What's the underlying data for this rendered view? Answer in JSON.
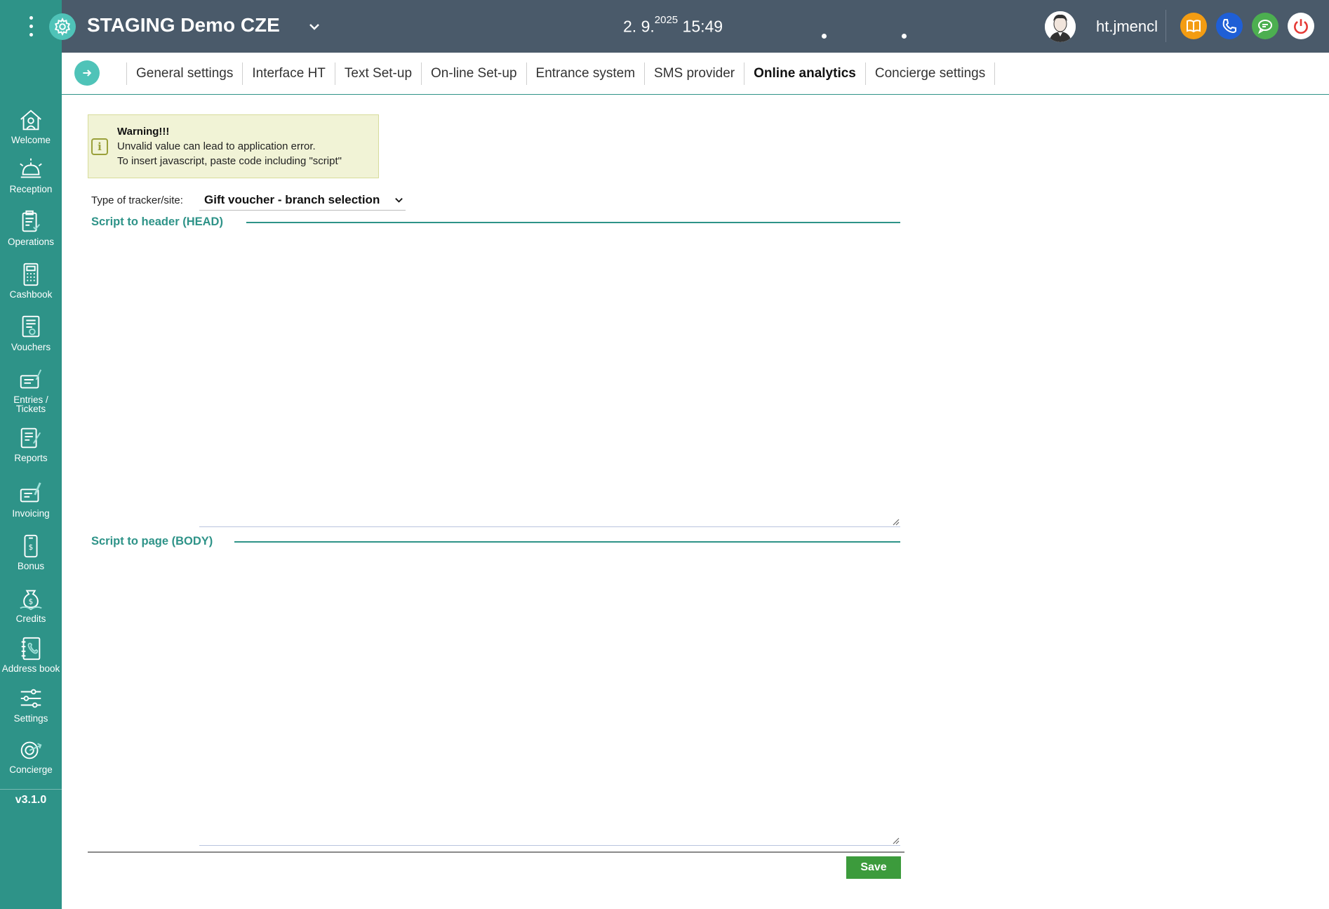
{
  "header": {
    "app_title": "STAGING Demo CZE",
    "date": "2. 9.",
    "year": "2025",
    "time": "15:49",
    "username": "ht.jmencl",
    "buttons": [
      {
        "name": "book",
        "color": "#f39c12"
      },
      {
        "name": "phone",
        "color": "#1f5fd6"
      },
      {
        "name": "chat",
        "color": "#4caf50"
      },
      {
        "name": "power",
        "color": "#ffffff"
      }
    ]
  },
  "sidebar": {
    "items": [
      {
        "label": "Welcome",
        "icon": "home-icon"
      },
      {
        "label": "Reception",
        "icon": "bell-icon"
      },
      {
        "label": "Operations",
        "icon": "clipboard-icon"
      },
      {
        "label": "Cashbook",
        "icon": "calculator-icon"
      },
      {
        "label": "Vouchers",
        "icon": "voucher-icon"
      },
      {
        "label": "Entries /",
        "label2": "Tickets",
        "icon": "ticket-icon"
      },
      {
        "label": "Reports",
        "icon": "report-icon"
      },
      {
        "label": "Invoicing",
        "icon": "invoice-icon"
      },
      {
        "label": "Bonus",
        "icon": "bonus-icon"
      },
      {
        "label": "Credits",
        "icon": "credits-icon"
      },
      {
        "label": "Address book",
        "icon": "address-book-icon"
      },
      {
        "label": "Settings",
        "icon": "sliders-icon"
      },
      {
        "label": "Concierge",
        "icon": "concierge-icon"
      }
    ],
    "version": "v3.1.0"
  },
  "tabs": [
    {
      "label": "General settings",
      "active": false
    },
    {
      "label": "Interface HT",
      "active": false
    },
    {
      "label": "Text Set-up",
      "active": false
    },
    {
      "label": "On-line Set-up",
      "active": false
    },
    {
      "label": "Entrance system",
      "active": false
    },
    {
      "label": "SMS provider",
      "active": false
    },
    {
      "label": "Online analytics",
      "active": true
    },
    {
      "label": "Concierge settings",
      "active": false
    }
  ],
  "warning": {
    "title": "Warning!!!",
    "line1": "Unvalid value can lead to application error.",
    "line2": "To insert javascript, paste code including \"script\""
  },
  "tracker": {
    "label": "Type of tracker/site:",
    "selected": "Gift voucher - branch selection"
  },
  "sections": {
    "head_title": "Script to header (HEAD)",
    "head_value": "",
    "body_title": "Script to page (BODY)",
    "body_value": ""
  },
  "actions": {
    "save_label": "Save"
  },
  "colors": {
    "sidebar": "#2e9388",
    "header": "#4a5a6a",
    "accent": "#4fc3b8",
    "save": "#3c9b3c"
  }
}
